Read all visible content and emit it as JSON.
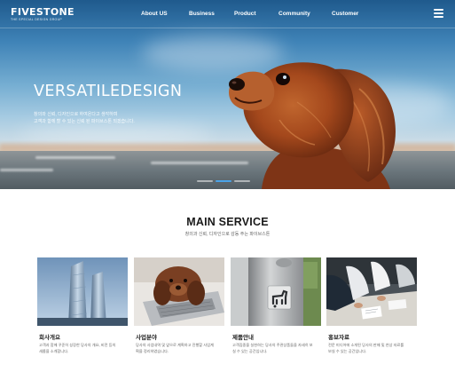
{
  "header": {
    "logo": "FIVESTONE",
    "logo_tagline": "THE SPECIAL DESIGN GROUP",
    "nav": [
      {
        "label": "About US"
      },
      {
        "label": "Business"
      },
      {
        "label": "Product"
      },
      {
        "label": "Community"
      },
      {
        "label": "Customer"
      }
    ],
    "menu_icon": "hamburger-menu-icon"
  },
  "hero": {
    "title": "VERSATILEDESIGN",
    "description_lines": [
      "창의와 신뢰, 디자인으로 하여온다고 생각하며",
      "고객과 함께 할 수 있는 신뢰 된 파이브스톤 되겠습니다."
    ],
    "slide_count": 3,
    "active_slide": 2
  },
  "main_service": {
    "title": "MAIN SERVICE",
    "subtitle": "창의과 신뢰, 디자인으로 감동 주는 파이브스톤",
    "cards": [
      {
        "title": "회사개요",
        "desc_lines": [
          "고객과 함께 꾸준히 성장한 당사의 개요, 비전 등의",
          "새롭을 소개합니다."
        ],
        "image": "skyscraper-photo"
      },
      {
        "title": "사업분야",
        "desc_lines": [
          "당사의 사업내역 및 앞으로 계획하고 진행할 사업계",
          "획을 정리하였습니다."
        ],
        "image": "dog-on-laptop-photo"
      },
      {
        "title": "제품안내",
        "desc_lines": [
          "고객집중을 실현하는 당사의 주관상품들을 자세히 보",
          "실 수 있는 공간입니다."
        ],
        "image": "dog-sign-photo"
      },
      {
        "title": "홍보자료",
        "desc_lines": [
          "전문 미디어에 소개된 당사의 판매 및 연상 자료를",
          "보실 수 있는 공간입니다."
        ],
        "image": "meeting-photo"
      }
    ]
  },
  "colors": {
    "accent": "#ffffff",
    "sky_top": "#1f5a8d",
    "dog_fur": "#a4481c"
  }
}
